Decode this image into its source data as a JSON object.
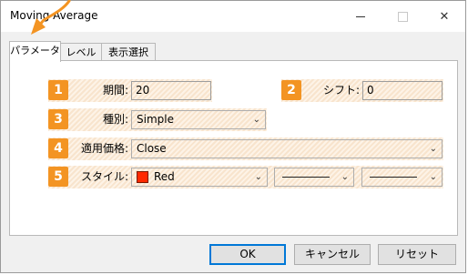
{
  "window": {
    "title": "Moving Average"
  },
  "tabs": [
    {
      "label": "パラメータ"
    },
    {
      "label": "レベル"
    },
    {
      "label": "表示選択"
    }
  ],
  "rows": {
    "period": {
      "number": "1",
      "label": "期間:",
      "value": "20"
    },
    "shift": {
      "number": "2",
      "label": "シフト:",
      "value": "0"
    },
    "method": {
      "number": "3",
      "label": "種別:",
      "value": "Simple"
    },
    "apply": {
      "number": "4",
      "label": "適用価格:",
      "value": "Close"
    },
    "style": {
      "number": "5",
      "label": "スタイル:",
      "color_name": "Red",
      "color": "#ff2a00"
    }
  },
  "buttons": {
    "ok": "OK",
    "cancel": "キャンセル",
    "reset": "リセット"
  },
  "colors": {
    "accent": "#f39423",
    "row_highlight": "#f8e4cd",
    "focus_border": "#0078d7"
  }
}
